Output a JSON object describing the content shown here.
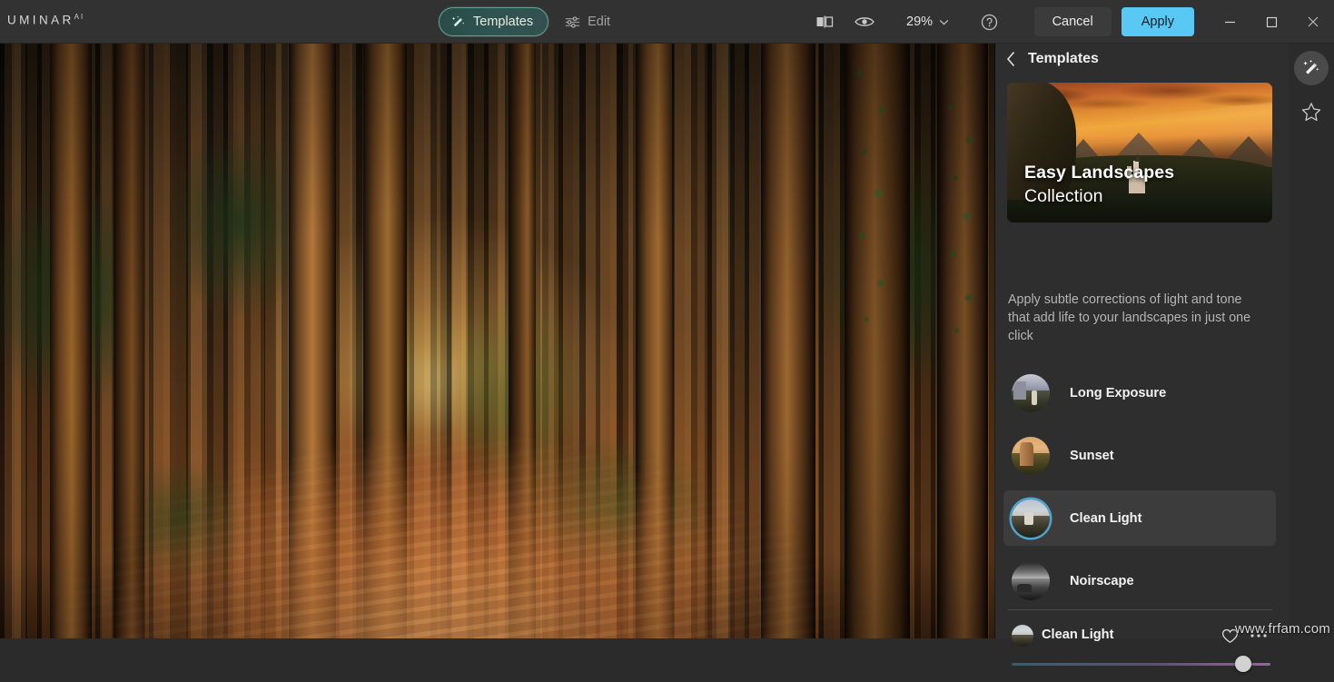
{
  "app": {
    "brand": "UMINAR",
    "brand_suffix": "AI"
  },
  "toolbar": {
    "modes": [
      {
        "label": "Templates",
        "icon": "magic-wand-icon",
        "active": true
      },
      {
        "label": "Edit",
        "icon": "sliders-icon",
        "active": false
      }
    ],
    "compare_icon": "compare-split-icon",
    "preview_icon": "eye-icon",
    "zoom_value": "29%",
    "zoom_chevron_icon": "chevron-down-icon",
    "help_icon": "question-circle-icon",
    "cancel_label": "Cancel",
    "apply_label": "Apply",
    "window": {
      "minimize_icon": "minimize-icon",
      "maximize_icon": "maximize-icon",
      "close_icon": "close-icon"
    }
  },
  "panel": {
    "back_icon": "chevron-left-icon",
    "title": "Templates",
    "hero": {
      "line1": "Easy Landscapes",
      "line2": "Collection"
    },
    "description": "Apply subtle corrections of light and tone that add life to your landscapes in just one click",
    "items": [
      {
        "label": "Long Exposure",
        "selected": false
      },
      {
        "label": "Sunset",
        "selected": false
      },
      {
        "label": "Clean Light",
        "selected": true
      },
      {
        "label": "Noirscape",
        "selected": false
      }
    ],
    "rail": [
      {
        "icon": "magic-wand-icon",
        "active": true
      },
      {
        "icon": "star-outline-icon",
        "active": false
      }
    ]
  },
  "bottom": {
    "name": "Clean Light",
    "favorite_icon": "heart-outline-icon",
    "more_icon": "more-dots-icon",
    "slider_percent": 92
  },
  "watermark": "www.frfam.com",
  "colors": {
    "accent_apply": "#5ac8f5",
    "accent_selected_ring": "#4fa3cc",
    "panel_bg": "#2e2e2e",
    "topbar_bg": "#323232",
    "templates_border": "#5fa396"
  }
}
